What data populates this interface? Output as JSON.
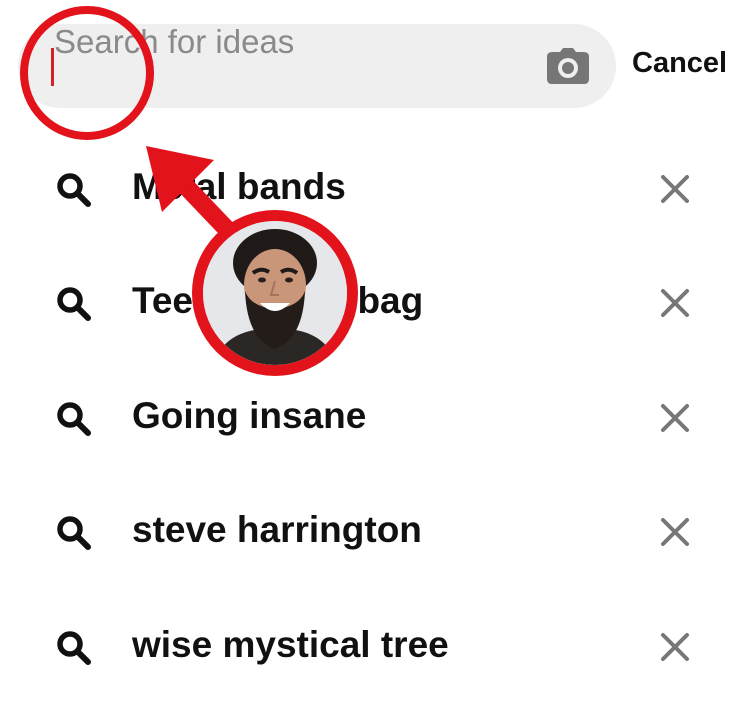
{
  "search": {
    "placeholder": "Search for ideas",
    "value": "",
    "cancel_label": "Cancel",
    "camera_icon": "camera-icon"
  },
  "recent_searches": [
    {
      "text": "Metal bands",
      "icon": "search-icon",
      "remove_icon": "close-icon"
    },
    {
      "text": "Teen douchebag",
      "icon": "search-icon",
      "remove_icon": "close-icon"
    },
    {
      "text": "Going insane",
      "icon": "search-icon",
      "remove_icon": "close-icon"
    },
    {
      "text": "steve harrington",
      "icon": "search-icon",
      "remove_icon": "close-icon"
    },
    {
      "text": "wise mystical tree",
      "icon": "search-icon",
      "remove_icon": "close-icon"
    }
  ],
  "annotation": {
    "color": "#e3131b",
    "arrow_target": "search-input",
    "avatar": "avatar-photo"
  },
  "colors": {
    "search_bg": "#efefef",
    "text_primary": "#111111",
    "placeholder": "#8a8a8a",
    "icon_gray": "#777777",
    "caret": "#d61f26"
  }
}
